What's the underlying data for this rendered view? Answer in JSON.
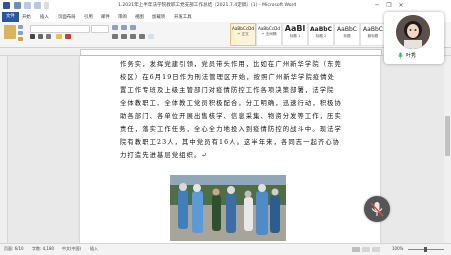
{
  "window": {
    "title": "1.2021年上半年法学院教职工党支部工作总结（2021.7.4定稿）(1) - Microsoft Word",
    "minimize": "─",
    "restore": "❐",
    "close": "✕"
  },
  "ribbon_tabs": [
    "文件",
    "开始",
    "插入",
    "页面布局",
    "引用",
    "邮件",
    "审阅",
    "视图",
    "加载项",
    "开发工具"
  ],
  "styles": [
    {
      "sample": "AaBbCcDd",
      "name": "↵ 正文"
    },
    {
      "sample": "AaBbCcDd",
      "name": "↵ 无间隔"
    },
    {
      "sample": "AaBl",
      "name": "标题 1"
    },
    {
      "sample": "AaBbC",
      "name": "标题 2"
    },
    {
      "sample": "AaBbC",
      "name": "标题"
    },
    {
      "sample": "AaBbC",
      "name": "副标题"
    },
    {
      "sample": "AaBbCcDd",
      "name": "不明显强调"
    }
  ],
  "document": {
    "lines": [
      "作务实，发挥党建引领，党员带头作用，比如在广州新华学院（东莞",
      "校区）在6月19日作为刑法管理区开始，按照广州新华学院疫情处",
      "置工作专班及上级主管部门对疫情防控工作各项决策部署，法学院",
      "全体教职工、全体教工党员积极配合，分工明确，迅速行动，积极协",
      "助各部门、各单位开展出售核学、信息采集、物资分发等工作，压实",
      "责任，落实工作任务，全心全力地投入到疫情防控的战斗中。现法学",
      "院有教职工23人，其中党员有16人。这半年来，各同志一起齐心协",
      "力打造先进基层党组织。↵"
    ]
  },
  "status_bar": {
    "page": "页面: 6/10",
    "words": "字数: 4,180",
    "language": "中文(中国)",
    "mode": "插入",
    "zoom": "100%"
  },
  "video_call": {
    "speaker_name": "叶秀"
  },
  "colors": {
    "file_tab": "#2b579a",
    "mic_active": "#2dbb6b"
  }
}
